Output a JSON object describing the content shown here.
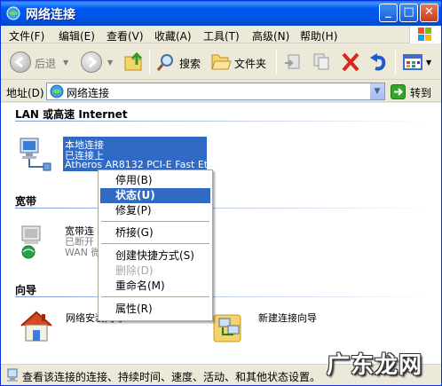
{
  "window": {
    "title": "网络连接"
  },
  "menubar": {
    "items": [
      "文件(F)",
      "编辑(E)",
      "查看(V)",
      "收藏(A)",
      "工具(T)",
      "高级(N)",
      "帮助(H)"
    ]
  },
  "toolbar": {
    "back": "后退",
    "search": "搜索",
    "folders": "文件夹"
  },
  "address": {
    "label": "地址(D)",
    "value": "网络连接",
    "go": "转到"
  },
  "groups": {
    "lan": "LAN 或高速 Internet",
    "broadband": "宽带",
    "wizard": "向导"
  },
  "lan_item": {
    "name": "本地连接",
    "status": "已连接上",
    "device": "Atheros AR8132 PCI-E Fast Et..."
  },
  "broadband_item": {
    "name": "宽带连",
    "status": "已断开",
    "device": "WAN 微"
  },
  "wizard_items": {
    "network_setup": "网络安装向导",
    "new_connection": "新建连接向导"
  },
  "context_menu": {
    "disable": "停用(B)",
    "status": "状态(U)",
    "repair": "修复(P)",
    "bridge": "桥接(G)",
    "create_shortcut": "创建快捷方式(S)",
    "delete": "删除(D)",
    "rename": "重命名(M)",
    "properties": "属性(R)"
  },
  "statusbar": {
    "text": "查看该连接的连接、持续时间、速度、活动、和其他状态设置。"
  },
  "watermark": {
    "text": "广东龙网"
  }
}
